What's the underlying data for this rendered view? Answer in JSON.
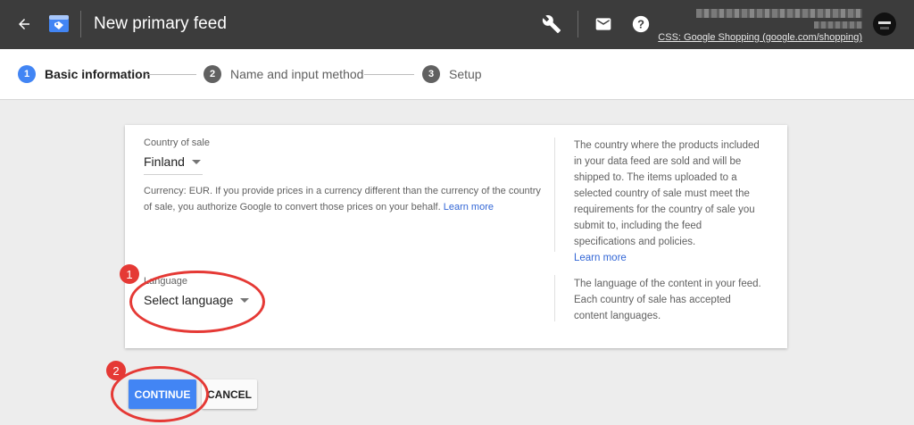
{
  "topbar": {
    "title": "New primary feed",
    "account_name": "CSS: Google Shopping (google.com/shopping)",
    "icons": {
      "back": "arrow-back-icon",
      "logo": "merchant-center-icon",
      "tools": "wrench-icon",
      "mail": "mail-icon",
      "help": "help-icon",
      "avatar": "avatar"
    }
  },
  "stepper": {
    "steps": [
      {
        "number": "1",
        "label": "Basic information",
        "active": true
      },
      {
        "number": "2",
        "label": "Name and input method",
        "active": false
      },
      {
        "number": "3",
        "label": "Setup",
        "active": false
      }
    ]
  },
  "card": {
    "country": {
      "label": "Country of sale",
      "value": "Finland",
      "helper_text": "Currency: EUR. If you provide prices in a currency different than the currency of the country of sale, you authorize Google to convert those prices on your behalf.",
      "helper_link": "Learn more",
      "description": "The country where the products included in your data feed are sold and will be shipped to. The items uploaded to a selected country of sale must meet the requirements for the country of sale you submit to, including the feed specifications and policies.",
      "description_link": "Learn more"
    },
    "language": {
      "label": "Language",
      "placeholder": "Select language",
      "description": "The language of the content in your feed. Each country of sale has accepted content languages."
    }
  },
  "actions": {
    "continue_label": "CONTINUE",
    "cancel_label": "CANCEL"
  },
  "annotations": {
    "badge_1": "1",
    "badge_2": "2",
    "color": "#e53935"
  },
  "colors": {
    "topbar": "#3c3c3c",
    "accent": "#4285f4",
    "link": "#3367d6"
  }
}
